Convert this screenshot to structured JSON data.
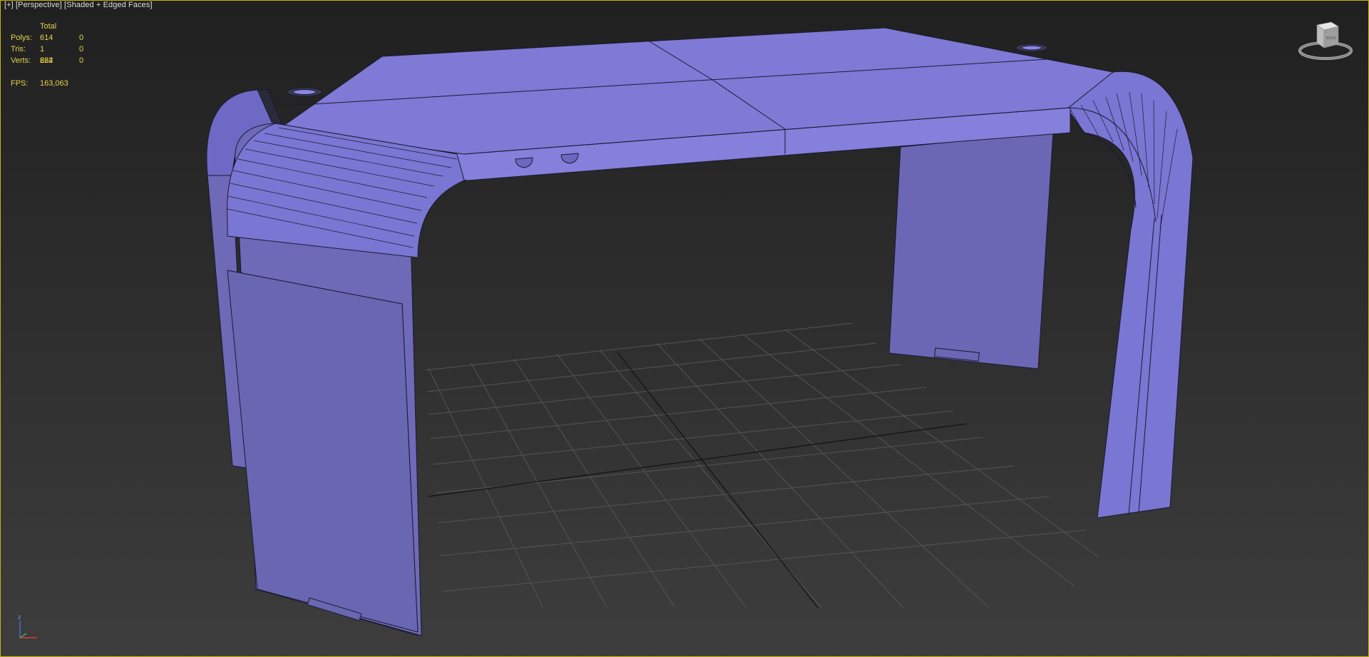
{
  "viewport": {
    "label_plus": "[+]",
    "label_view": "[Perspective]",
    "label_shading": "[Shaded + Edged Faces]",
    "active_border_color": "#c8b400",
    "object_color": "#7b78d6",
    "edge_color": "#1a1a2e"
  },
  "stats": {
    "header": "Total",
    "rows": [
      {
        "label": "Polys:",
        "total": "614",
        "selected": "0"
      },
      {
        "label": "Tris:",
        "total": "1 224",
        "selected": "0"
      },
      {
        "label": "Verts:",
        "total": "682",
        "selected": "0"
      }
    ],
    "fps_label": "FPS:",
    "fps_value": "163,063"
  },
  "viewcube": {
    "face_label": "BACK",
    "icon": "viewcube-icon"
  },
  "axis_tripod": {
    "z_label": "z",
    "icon": "axis-tripod-icon"
  }
}
